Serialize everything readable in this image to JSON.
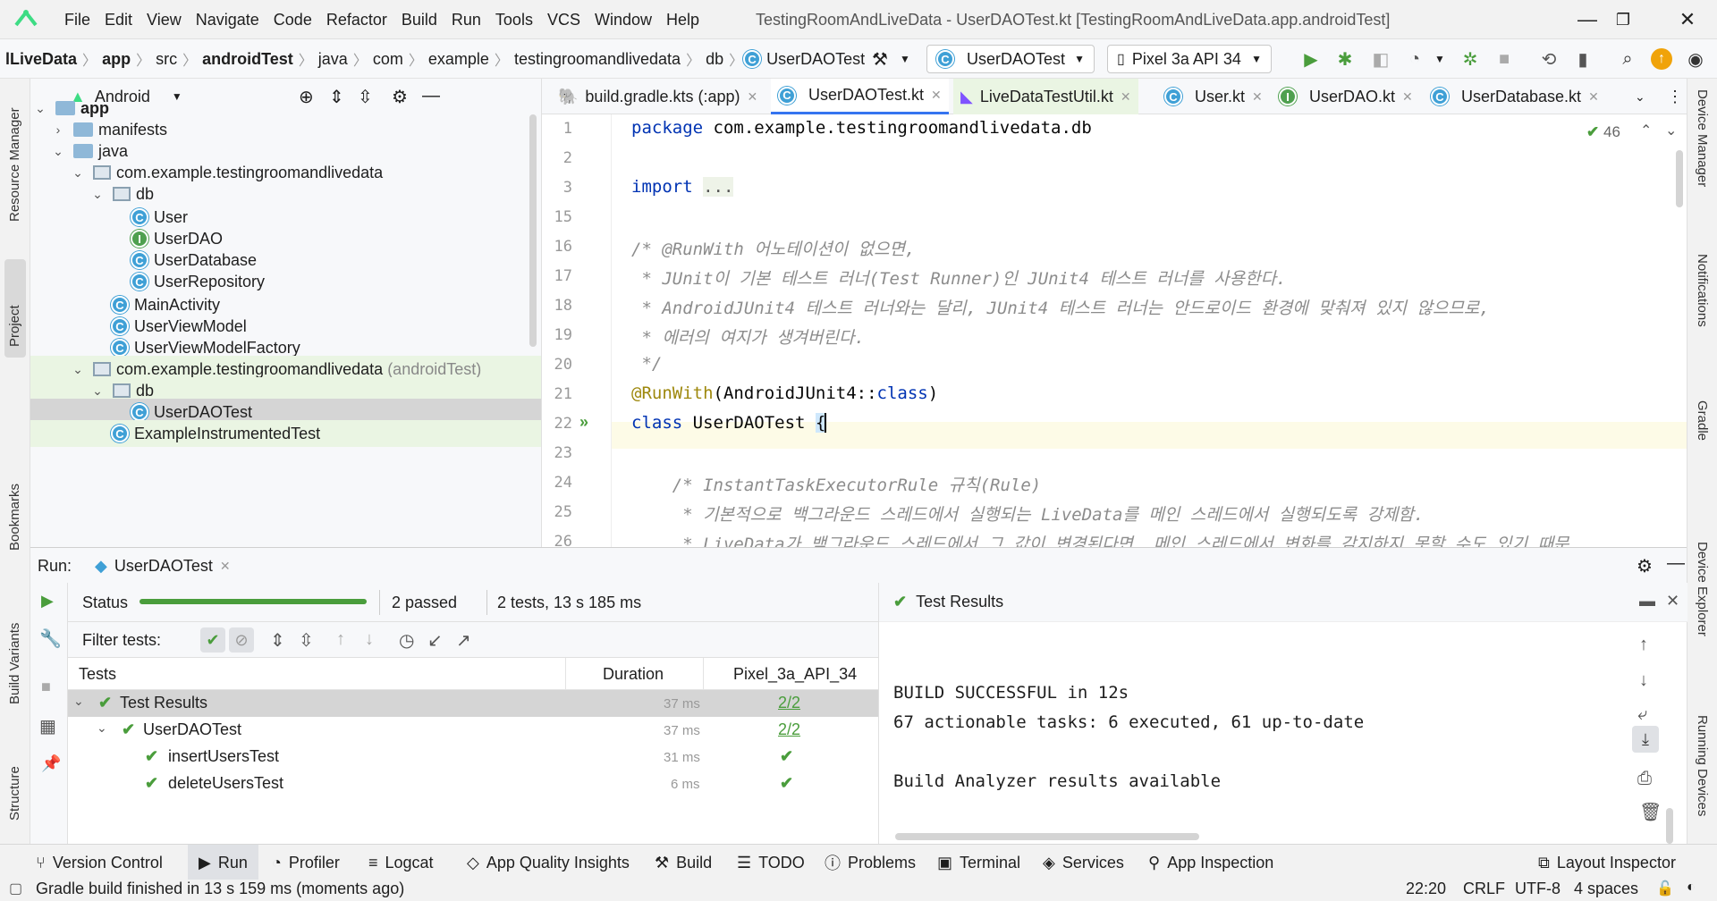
{
  "menu": [
    "File",
    "Edit",
    "View",
    "Navigate",
    "Code",
    "Refactor",
    "Build",
    "Run",
    "Tools",
    "VCS",
    "Window",
    "Help"
  ],
  "window_title": "TestingRoomAndLiveData - UserDAOTest.kt [TestingRoomAndLiveData.app.androidTest]",
  "breadcrumbs": [
    "lLiveData",
    "app",
    "src",
    "androidTest",
    "java",
    "com",
    "example",
    "testingroomandlivedata",
    "db",
    "UserDAOTest"
  ],
  "run_config": "UserDAOTest",
  "device": "Pixel 3a API 34",
  "left_stripe": {
    "resource_manager": "Resource Manager",
    "project": "Project",
    "bookmarks": "Bookmarks",
    "build_variants": "Build Variants",
    "structure": "Structure"
  },
  "right_stripe": {
    "device_manager": "Device Manager",
    "notifications": "Notifications",
    "gradle": "Gradle",
    "device_explorer": "Device Explorer",
    "running_devices": "Running Devices"
  },
  "project": {
    "view": "Android",
    "tree": [
      {
        "label": "app",
        "kind": "module",
        "bold": true
      },
      {
        "label": "manifests",
        "kind": "folder"
      },
      {
        "label": "java",
        "kind": "folder"
      },
      {
        "label": "com.example.testingroomandlivedata",
        "kind": "package"
      },
      {
        "label": "db",
        "kind": "package"
      },
      {
        "label": "User",
        "kind": "class"
      },
      {
        "label": "UserDAO",
        "kind": "interface"
      },
      {
        "label": "UserDatabase",
        "kind": "class"
      },
      {
        "label": "UserRepository",
        "kind": "class"
      },
      {
        "label": "MainActivity",
        "kind": "class"
      },
      {
        "label": "UserViewModel",
        "kind": "class"
      },
      {
        "label": "UserViewModelFactory",
        "kind": "class"
      },
      {
        "label": "com.example.testingroomandlivedata",
        "suffix": "(androidTest)",
        "kind": "package"
      },
      {
        "label": "db",
        "kind": "package"
      },
      {
        "label": "UserDAOTest",
        "kind": "class"
      },
      {
        "label": "ExampleInstrumentedTest",
        "kind": "class"
      }
    ]
  },
  "editor": {
    "tabs": [
      "build.gradle.kts (:app)",
      "UserDAOTest.kt",
      "LiveDataTestUtil.kt",
      "User.kt",
      "UserDAO.kt",
      "UserDatabase.kt"
    ],
    "inspection_count": "46",
    "lines": [
      {
        "n": "1",
        "text": "package com.example.testingroomandlivedata.db"
      },
      {
        "n": "2",
        "text": ""
      },
      {
        "n": "3",
        "text": "import ..."
      },
      {
        "n": "15",
        "text": ""
      },
      {
        "n": "16",
        "text": "/* @RunWith 어노테이션이 없으면,"
      },
      {
        "n": "17",
        "text": " * JUnit이 기본 테스트 러너(Test Runner)인 JUnit4 테스트 러너를 사용한다."
      },
      {
        "n": "18",
        "text": " * AndroidJUnit4 테스트 러너와는 달리, JUnit4 테스트 러너는 안드로이드 환경에 맞춰져 있지 않으므로,"
      },
      {
        "n": "19",
        "text": " * 에러의 여지가 생겨버린다."
      },
      {
        "n": "20",
        "text": " */"
      },
      {
        "n": "21",
        "text": "@RunWith(AndroidJUnit4::class)"
      },
      {
        "n": "22",
        "text": "class UserDAOTest {"
      },
      {
        "n": "23",
        "text": ""
      },
      {
        "n": "24",
        "text": "    /* InstantTaskExecutorRule 규칙(Rule)"
      },
      {
        "n": "25",
        "text": "     * 기본적으로 백그라운드 스레드에서 실행되는 LiveData를 메인 스레드에서 실행되도록 강제함."
      },
      {
        "n": "26",
        "text": "     * LiveData가 백그라운드 스레드에서 그 값이 변경된다면, 메인 스레드에서 변화를 감지하지 못할 수도 있기 때문."
      }
    ]
  },
  "run": {
    "label": "Run:",
    "config": "UserDAOTest",
    "status_label": "Status",
    "progress": 1.0,
    "passed": "2 passed",
    "summary": "2 tests, 13 s 185 ms",
    "filter_label": "Filter tests:",
    "columns": [
      "Tests",
      "Duration",
      "Pixel_3a_API_34"
    ],
    "rows": [
      {
        "name": "Test Results",
        "duration": "37 ms",
        "result": "2/2",
        "level": 0
      },
      {
        "name": "UserDAOTest",
        "duration": "37 ms",
        "result": "2/2",
        "level": 1
      },
      {
        "name": "insertUsersTest",
        "duration": "31 ms",
        "result": "✔",
        "level": 2
      },
      {
        "name": "deleteUsersTest",
        "duration": "6 ms",
        "result": "✔",
        "level": 2
      }
    ],
    "console_title": "Test Results",
    "console_lines": [
      "BUILD SUCCESSFUL in 12s",
      "67 actionable tasks: 6 executed, 61 up-to-date",
      "",
      "Build Analyzer results available"
    ]
  },
  "toolwindows": [
    "Version Control",
    "Run",
    "Profiler",
    "Logcat",
    "App Quality Insights",
    "Build",
    "TODO",
    "Problems",
    "Terminal",
    "Services",
    "App Inspection",
    "Layout Inspector"
  ],
  "statusbar": {
    "message": "Gradle build finished in 13 s 159 ms (moments ago)",
    "position": "22:20",
    "line_sep": "CRLF",
    "encoding": "UTF-8",
    "indent": "4 spaces"
  },
  "colors": {
    "accent": "#3574f0",
    "success": "#4a9d3c",
    "selection": "#d5d5d5"
  }
}
